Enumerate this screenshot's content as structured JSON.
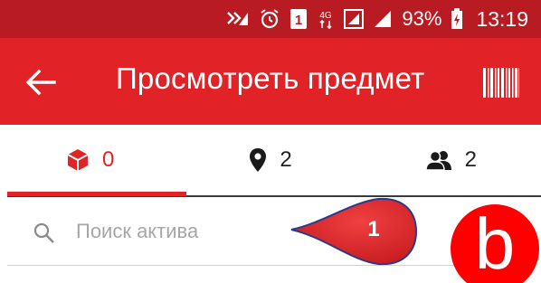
{
  "status_bar": {
    "battery_percent": "93%",
    "time": "13:19",
    "network_label": "4G",
    "sim_label": "1",
    "icons": [
      "signal-weak-icon",
      "alarm-icon",
      "sim-1-icon",
      "network-4g-icon",
      "signal-icon",
      "battery-charging-icon"
    ]
  },
  "app_bar": {
    "title": "Просмотреть предмет",
    "back_icon": "arrow-left-icon",
    "action_icon": "barcode-icon"
  },
  "tabs": [
    {
      "icon": "cube-icon",
      "count": "0",
      "active": true
    },
    {
      "icon": "location-pin-icon",
      "count": "2",
      "active": false
    },
    {
      "icon": "users-icon",
      "count": "2",
      "active": false
    }
  ],
  "search": {
    "placeholder": "Поиск актива",
    "value": ""
  },
  "annotations": {
    "callout_number": "1",
    "badge_letter": "b"
  },
  "colors": {
    "status_bar": "#b81c22",
    "app_bar": "#e12328",
    "accent": "#e12328",
    "callout": "#d91a20",
    "badge": "#ff0000"
  }
}
